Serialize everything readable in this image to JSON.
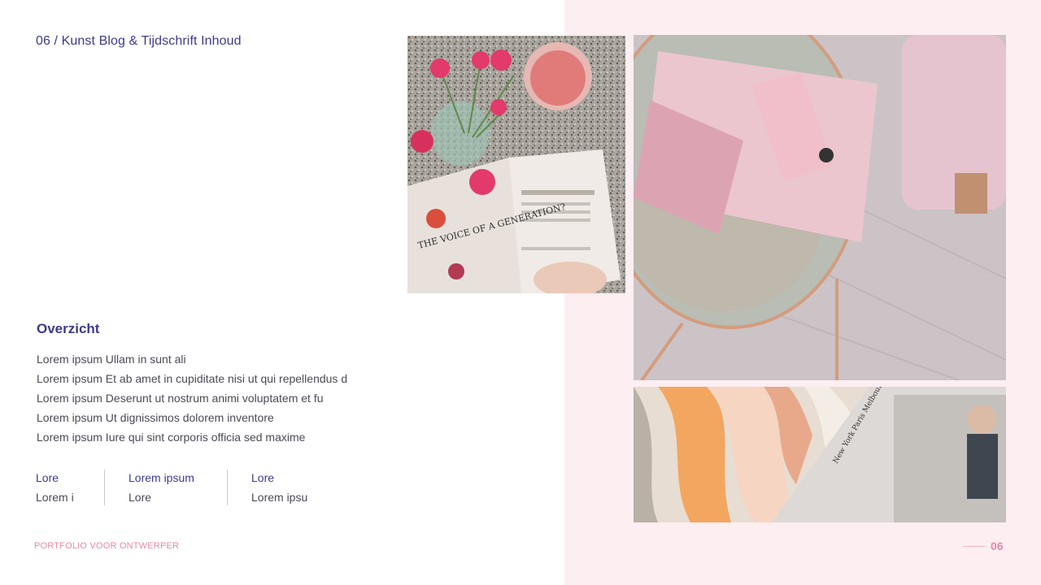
{
  "header": {
    "title": "06 / Kunst Blog & Tijdschrift Inhoud"
  },
  "overview": {
    "heading": "Overzicht",
    "lines": [
      "Lorem ipsum Ullam in sunt ali",
      "Lorem ipsum Et ab amet in cupiditate nisi ut qui repellendus d",
      "Lorem ipsum Deserunt ut nostrum animi voluptatem et fu",
      "Lorem ipsum Ut dignissimos dolorem inventore",
      "Lorem ipsum Iure qui sint corporis officia sed maxime"
    ]
  },
  "stats": [
    {
      "label": "Lore",
      "value": "Lorem i"
    },
    {
      "label": "Lorem ipsum",
      "value": "Lore"
    },
    {
      "label": "Lore",
      "value": "Lorem ipsu"
    }
  ],
  "footer": {
    "left": "PORTFOLIO VOOR ONTWERPER",
    "page": "06"
  },
  "photos": {
    "photo1_magazine_text": "THE VOICE OF A GENERATION?",
    "photo3_magazine_text": "New York Paris Melbourne Tokyo Madrid London"
  },
  "colors": {
    "accent": "#3d3a8c",
    "pink": "#e58aa3",
    "panel": "#fdeef2",
    "body": "#4a4a55"
  }
}
